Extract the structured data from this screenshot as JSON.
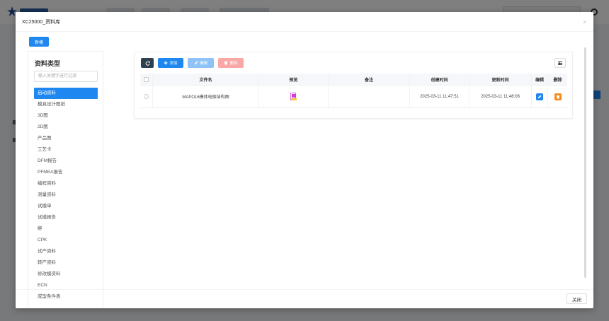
{
  "modal": {
    "title": "XC25000_资料库",
    "close_glyph": "×",
    "new_button": "新模",
    "footer_close": "关闭"
  },
  "left": {
    "title": "资料类型",
    "search_placeholder": "输入关键字进行过滤",
    "items": [
      {
        "label": "启动资料",
        "active": true
      },
      {
        "label": "模具设计图纸"
      },
      {
        "label": "3D图"
      },
      {
        "label": "2D图"
      },
      {
        "label": "产品图"
      },
      {
        "label": "工艺卡"
      },
      {
        "label": "DFM报告"
      },
      {
        "label": "PFMEA报告"
      },
      {
        "label": "编程资料"
      },
      {
        "label": "测量资料"
      },
      {
        "label": "试模单"
      },
      {
        "label": "试模报告"
      },
      {
        "label": "孵"
      },
      {
        "label": "CPK"
      },
      {
        "label": "试产资料"
      },
      {
        "label": "转产资料"
      },
      {
        "label": "修改模资料"
      },
      {
        "label": "ECN"
      },
      {
        "label": "成型条件表"
      }
    ]
  },
  "toolbar": {
    "add": "添加",
    "edit": "编辑",
    "delete": "删除"
  },
  "table": {
    "headers": {
      "filename": "文件名",
      "preview": "预览",
      "remark": "备注",
      "created": "创建时间",
      "updated": "更新时间",
      "edit": "编辑",
      "delete": "删除"
    },
    "rows": [
      {
        "filename": "MAPO16模体电极结构图",
        "remark": "",
        "created": "2025-03-11 11:47:51",
        "updated": "2025-03-11 11:48:06"
      }
    ]
  },
  "icons": {
    "refresh": "refresh-icon",
    "plus": "plus-icon",
    "pencil": "pencil-icon",
    "trash": "trash-icon",
    "columns": "columns-icon",
    "file_preview": "file-preview-icon"
  },
  "colors": {
    "primary": "#1e87f0",
    "dark": "#2f4050",
    "danger_light": "#f9a7a7",
    "warning": "#f78a1d",
    "preview_magenta": "#d63bd8"
  }
}
